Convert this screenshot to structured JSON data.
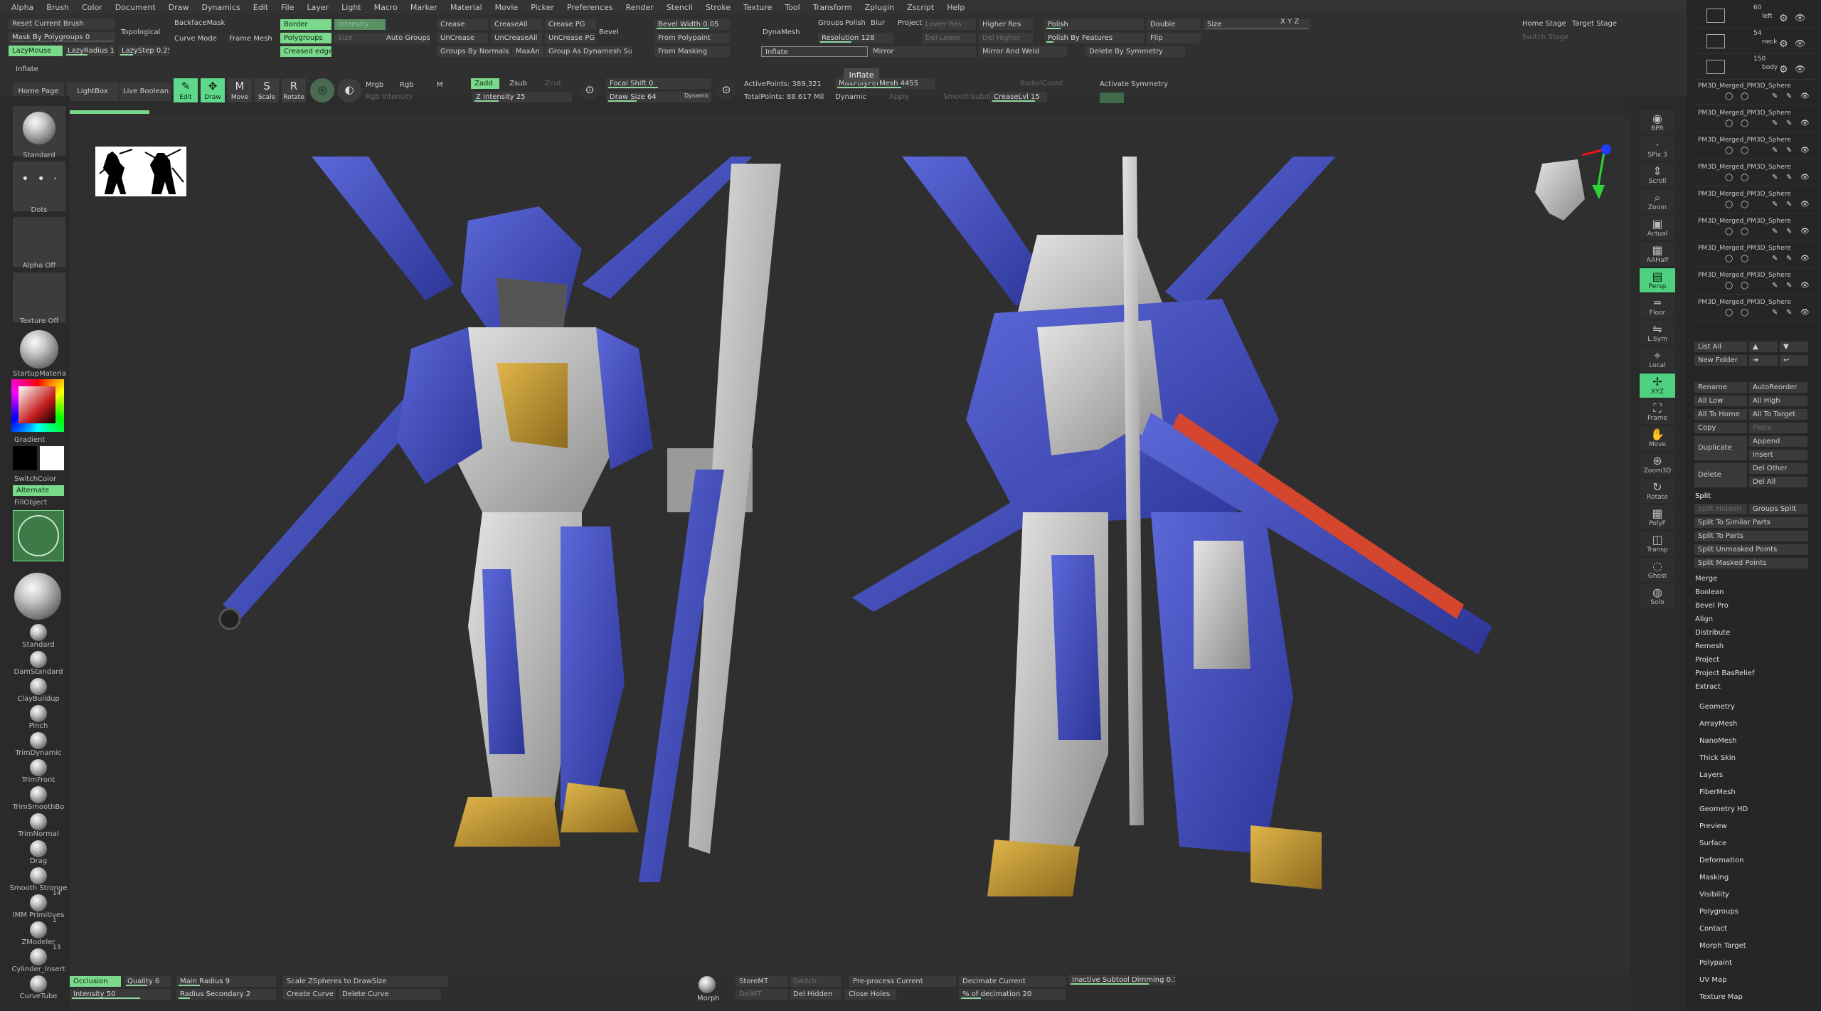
{
  "menubar": [
    "Alpha",
    "Brush",
    "Color",
    "Document",
    "Draw",
    "Dynamics",
    "Edit",
    "File",
    "Layer",
    "Light",
    "Macro",
    "Marker",
    "Material",
    "Movie",
    "Picker",
    "Preferences",
    "Render",
    "Stencil",
    "Stroke",
    "Texture",
    "Tool",
    "Transform",
    "Zplugin",
    "Zscript",
    "Help"
  ],
  "top": {
    "reset_current_brush": "Reset Current Brush",
    "mask_by_polygroups": "Mask By Polygroups 0",
    "lazymouse": "LazyMouse",
    "lazyradius": "LazyRadius 1",
    "lazystep": "LazyStep 0.25",
    "topological": "Topological",
    "backfacemask": "BackfaceMask",
    "curve_mode": "Curve Mode",
    "frame_mesh": "Frame Mesh",
    "border": "Border",
    "intensity_dim": "Intensity",
    "polygroups": "Polygroups",
    "size_dim": "Size",
    "creased_edges": "Creased edges",
    "auto_groups": "Auto Groups",
    "crease": "Crease",
    "creaseall": "CreaseAll",
    "crease_pg": "Crease PG",
    "uncrease": "UnCrease",
    "uncreaseall": "UnCreaseAll",
    "uncrease_pg": "UnCrease PG",
    "groups_by_normals": "Groups By Normals",
    "maxan": "MaxAn",
    "group_as_dynamesh_sub": "Group As Dynamesh Sub",
    "bevel": "Bevel",
    "bevel_width": "Bevel Width 0.05",
    "from_polypaint": "From Polypaint",
    "from_masking": "From Masking",
    "dynamesh": "DynaMesh",
    "groups": "Groups",
    "polish": "Polish",
    "blur": "Blur",
    "project": "Project",
    "resolution": "Resolution 128",
    "inflate_field": "Inflate",
    "mirror": "Mirror",
    "lower_res": "Lower Res",
    "higher_res": "Higher Res",
    "del_lower": "Del Lower",
    "del_higher": "Del Higher",
    "mirror_and_weld": "Mirror And Weld",
    "polish2": "Polish",
    "polish_by_features": "Polish By Features",
    "delete_by_symmetry": "Delete By Symmetry",
    "double": "Double",
    "flip": "Flip",
    "size": "Size",
    "xyz": "X Y Z",
    "home_stage": "Home Stage",
    "target_stage": "Target Stage",
    "switch_stage": "Switch Stage",
    "inflate": "Inflate",
    "inflate_tooltip": "Inflate"
  },
  "row2": {
    "home_page": "Home Page",
    "lightbox": "LightBox",
    "live_boolean": "Live Boolean",
    "edit": "Edit",
    "draw": "Draw",
    "move": "Move",
    "scale": "Scale",
    "rotate": "Rotate",
    "mrgb": "Mrgb",
    "rgb": "Rgb",
    "m": "M",
    "rgb_intensity": "Rgb Intensity",
    "zadd": "Zadd",
    "zsub": "Zsub",
    "zcut": "Zcut",
    "z_intensity": "Z Intensity 25",
    "focal_shift": "Focal Shift 0",
    "draw_size": "Draw Size 64",
    "dynamic": "Dynamic",
    "active_points": "ActivePoints: 389,321",
    "total_points": "TotalPoints: 88.617 Mil",
    "max_poly": "MaxPolyPerMesh 4455",
    "dynamic2": "Dynamic",
    "apply": "Apply",
    "smooth_subdiv": "SmoothSubdiv",
    "radial_count": "RadialCount",
    "crease_lvl": "CreaseLvl 15",
    "activate_symmetry": "Activate Symmetry"
  },
  "left": {
    "standard": "Standard",
    "dots": "Dots",
    "alpha_off": "Alpha Off",
    "texture_off": "Texture Off",
    "startup_material": "StartupMateria",
    "gradient": "Gradient",
    "switchcolor": "SwitchColor",
    "alternate": "Alternate",
    "fillobject": "FillObject",
    "brushes": [
      "Standard",
      "DamStandard",
      "ClayBuildup",
      "Pinch",
      "TrimDynamic",
      "TrimFront",
      "TrimSmoothBo",
      "TrimNormal",
      "Drag",
      "Smooth Stronge",
      "IMM Primitives",
      "ZModeler",
      "Cylinder_Insert",
      "CurveTube"
    ],
    "badges": [
      "14",
      "1",
      "13"
    ]
  },
  "status": {
    "occlusion": "Occlusion",
    "quality": "Quality 6",
    "intensity": "Intensity 50",
    "main_radius": "Main Radius 9",
    "radius_secondary": "Radius Secondary 2",
    "scale_zspheres": "Scale ZSpheres to DrawSize",
    "create_curve": "Create Curve",
    "delete_curve": "Delete Curve",
    "morph": "Morph",
    "storemt": "StoreMT",
    "switch": "Switch",
    "delmt": "DelMT",
    "del_hidden": "Del Hidden",
    "preprocess": "Pre-process Current",
    "close_holes": "Close Holes",
    "decimate_current": "Decimate Current",
    "pct_decimation": "% of decimation 20",
    "inactive_dimming": "Inactive Subtool Dimming 0.75"
  },
  "right_shelf": [
    "BPR",
    "SPix 3",
    "Scroll",
    "Zoom",
    "Actual",
    "AAHalf",
    "Persp",
    "Floor",
    "L.Sym",
    "Local",
    "XYZ",
    "Frame",
    "Move",
    "Zoom3D",
    "Rotate",
    "PolyF",
    "Transp",
    "Ghost",
    "Solo"
  ],
  "subtools": {
    "top_items": [
      {
        "count": "60",
        "name": "left"
      },
      {
        "count": "54",
        "name": "neck"
      },
      {
        "count": "150",
        "name": "body"
      }
    ],
    "merged_name": "PM3D_Merged_PM3D_Sphere",
    "merged_count": 9
  },
  "tray": {
    "list_all": "List All",
    "new_folder": "New Folder",
    "rename": "Rename",
    "autoreorder": "AutoReorder",
    "all_low": "All Low",
    "all_high": "All High",
    "all_to_home": "All To Home",
    "all_to_target": "All To Target",
    "copy": "Copy",
    "paste": "Paste",
    "duplicate": "Duplicate",
    "append": "Append",
    "insert": "Insert",
    "delete": "Delete",
    "del_other": "Del Other",
    "del_all": "Del All",
    "split": "Split",
    "split_hidden": "Split Hidden",
    "groups_split": "Groups Split",
    "split_similar": "Split To Similar Parts",
    "split_parts": "Split To Parts",
    "split_unmasked": "Split Unmasked Points",
    "split_masked": "Split Masked Points",
    "sections": [
      "Merge",
      "Boolean",
      "Bevel Pro",
      "Align",
      "Distribute",
      "Remesh",
      "Project",
      "Project BasRelief",
      "Extract"
    ],
    "menus": [
      "Geometry",
      "ArrayMesh",
      "NanoMesh",
      "Thick Skin",
      "Layers",
      "FiberMesh",
      "Geometry HD",
      "Preview",
      "Surface",
      "Deformation",
      "Masking",
      "Visibility",
      "Polygroups",
      "Contact",
      "Morph Target",
      "Polypaint",
      "UV Map",
      "Texture Map"
    ]
  }
}
